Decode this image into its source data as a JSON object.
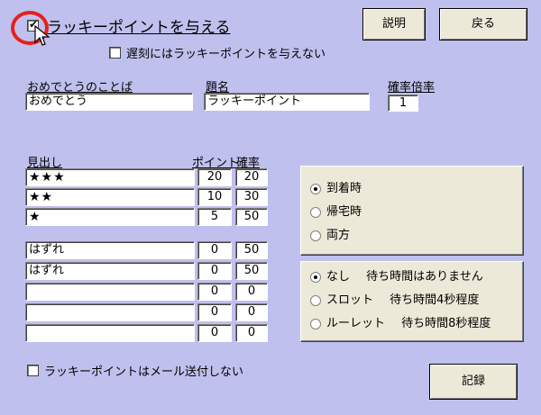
{
  "header": {
    "main_checkbox_label": "ラッキーポイントを与える",
    "main_checked": true,
    "late_checkbox_label": "遅刻にはラッキーポイントを与えない",
    "late_checked": false,
    "help_button": "説明",
    "back_button": "戻る"
  },
  "message": {
    "greeting_label": "おめでとうのことば",
    "greeting_value": "おめでとう",
    "title_label": "題名",
    "title_value": "ラッキーポイント",
    "multiplier_label": "確率倍率",
    "multiplier_value": "1"
  },
  "table": {
    "headers": {
      "heading": "見出し",
      "points": "ポイント",
      "probability": "確率"
    },
    "rows_top": [
      {
        "heading": "★★★",
        "points": "20",
        "probability": "20"
      },
      {
        "heading": "★★",
        "points": "10",
        "probability": "30"
      },
      {
        "heading": "★",
        "points": "5",
        "probability": "50"
      }
    ],
    "rows_bottom": [
      {
        "heading": "はずれ",
        "points": "0",
        "probability": "50"
      },
      {
        "heading": "はずれ",
        "points": "0",
        "probability": "50"
      },
      {
        "heading": "",
        "points": "0",
        "probability": "0"
      },
      {
        "heading": "",
        "points": "0",
        "probability": "0"
      },
      {
        "heading": "",
        "points": "0",
        "probability": "0"
      }
    ]
  },
  "timing": {
    "options": [
      "到着時",
      "帰宅時",
      "両方"
    ],
    "selected": 0
  },
  "effect": {
    "options": [
      {
        "name": "なし",
        "desc": "待ち時間はありません"
      },
      {
        "name": "スロット",
        "desc": "待ち時間4秒程度"
      },
      {
        "name": "ルーレット",
        "desc": "待ち時間8秒程度"
      }
    ],
    "selected": 0
  },
  "footer": {
    "no_mail_label": "ラッキーポイントはメール送付しない",
    "no_mail_checked": false,
    "record_button": "記録"
  },
  "colors": {
    "background": "#c0c0ee",
    "panel": "#ece9d8",
    "highlight": "#e8201a"
  }
}
